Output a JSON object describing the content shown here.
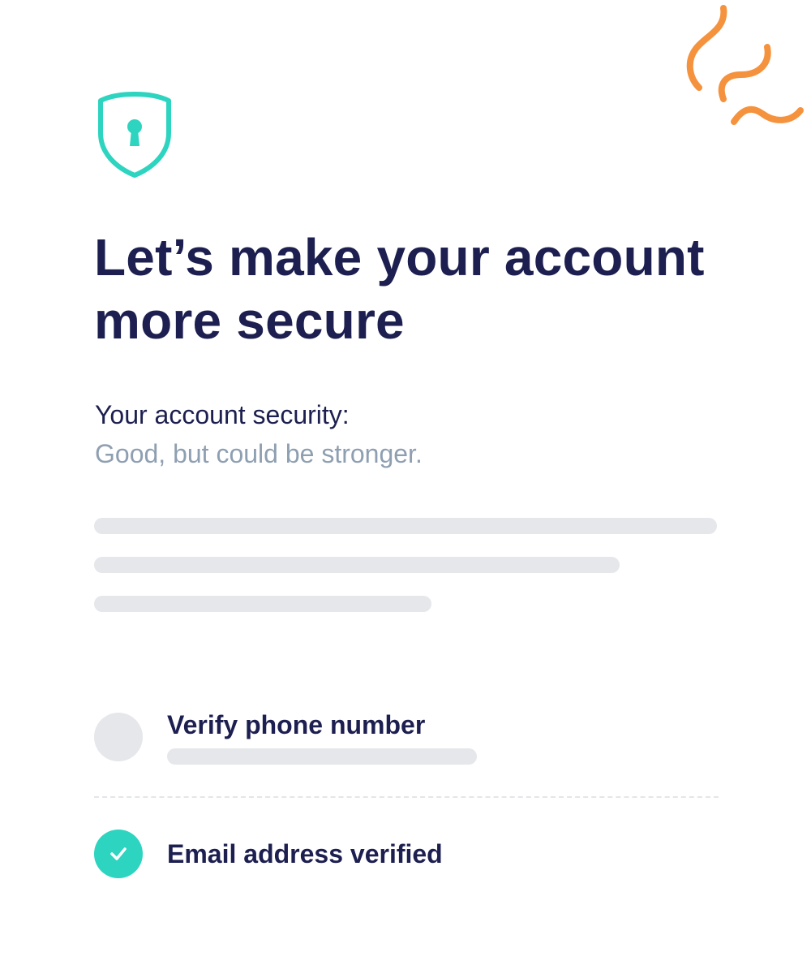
{
  "colors": {
    "brand_navy": "#1c1f4f",
    "accent_teal": "#2dd4bf",
    "muted_text": "#8e9fb1",
    "skeleton": "#e5e7eb",
    "decoration_orange": "#f5923e"
  },
  "icons": {
    "header_icon": "shield-keyhole-icon",
    "decoration": "squiggle-decoration",
    "done_icon": "checkmark-icon"
  },
  "headline": {
    "line1": "Let’s make your account",
    "line2": "more secure"
  },
  "security": {
    "label": "Your account security:",
    "status": "Good, but could be stronger."
  },
  "tasks": [
    {
      "label": "Verify phone number",
      "completed": false
    },
    {
      "label": "Email address verified",
      "completed": true
    }
  ]
}
